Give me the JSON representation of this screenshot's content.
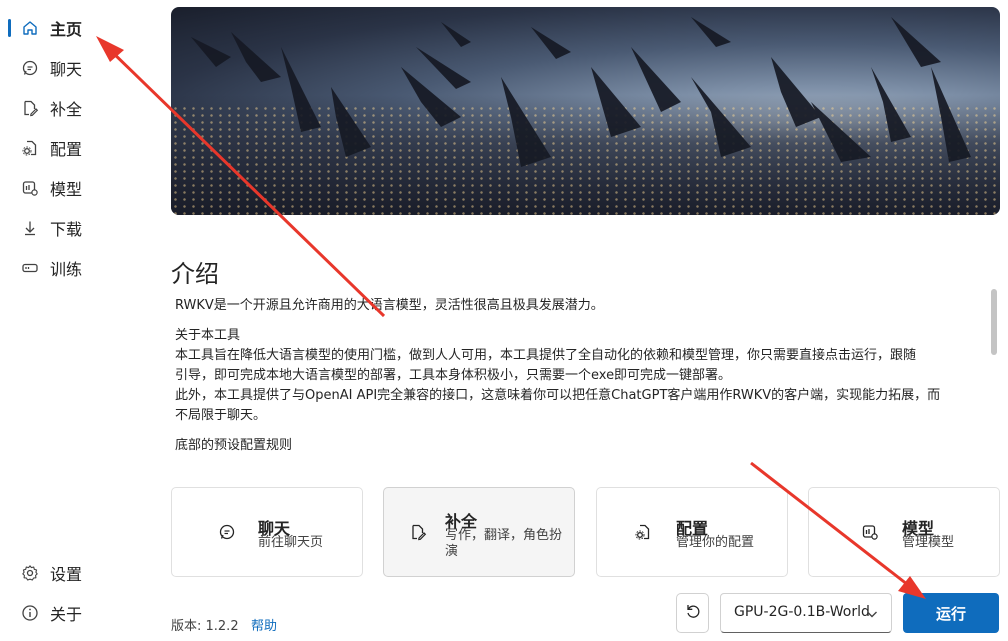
{
  "sidebar": {
    "items": [
      {
        "label": "主页",
        "icon": "home-icon"
      },
      {
        "label": "聊天",
        "icon": "chat-icon"
      },
      {
        "label": "补全",
        "icon": "document-edit-icon"
      },
      {
        "label": "配置",
        "icon": "document-settings-icon"
      },
      {
        "label": "模型",
        "icon": "model-icon"
      },
      {
        "label": "下载",
        "icon": "download-icon"
      },
      {
        "label": "训练",
        "icon": "train-icon"
      }
    ],
    "bottom_items": [
      {
        "label": "设置",
        "icon": "gear-icon"
      },
      {
        "label": "关于",
        "icon": "info-icon"
      }
    ]
  },
  "main": {
    "intro_title": "介绍",
    "intro_paragraphs": [
      "RWKV是一个开源且允许商用的大语言模型，灵活性很高且极具发展潜力。",
      "关于本工具",
      "本工具旨在降低大语言模型的使用门槛，做到人人可用，本工具提供了全自动化的依赖和模型管理，你只需要直接点击运行，跟随",
      "引导，即可完成本地大语言模型的部署，工具本身体积极小，只需要一个exe即可完成一键部署。",
      "此外，本工具提供了与OpenAI API完全兼容的接口，这意味着你可以把任意ChatGPT客户端用作RWKV的客户端，实现能力拓展，而",
      "不局限于聊天。",
      "底部的预设配置规则"
    ],
    "cards": [
      {
        "title": "聊天",
        "desc": "前往聊天页",
        "icon": "chat-icon"
      },
      {
        "title": "补全",
        "desc": "写作，翻译，角色扮演",
        "icon": "document-edit-icon"
      },
      {
        "title": "配置",
        "desc": "管理你的配置",
        "icon": "document-settings-icon"
      },
      {
        "title": "模型",
        "desc": "管理模型",
        "icon": "model-icon"
      }
    ]
  },
  "footer": {
    "version_label": "版本: 1.2.2",
    "help_label": "帮助",
    "model_selected": "GPU-2G-0.1B-World",
    "run_label": "运行"
  },
  "colors": {
    "accent": "#0f6cbd",
    "annotation_arrow": "#e8372b"
  }
}
